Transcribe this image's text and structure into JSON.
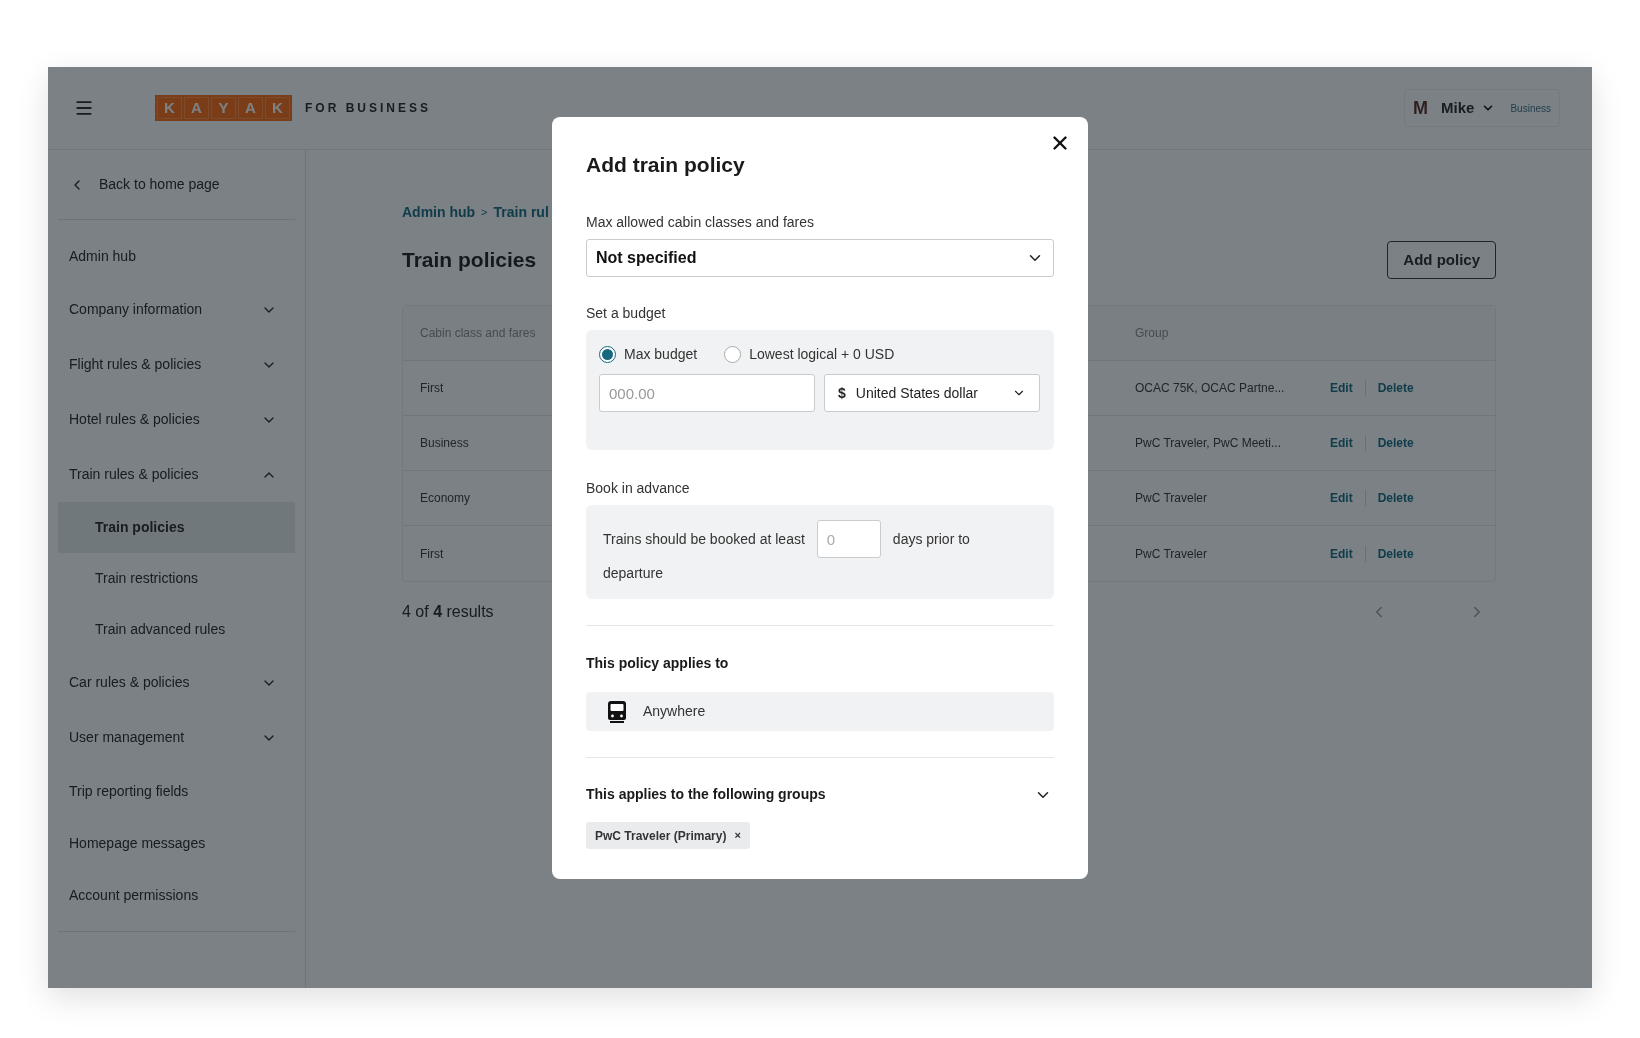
{
  "header": {
    "logo_letters": [
      "K",
      "A",
      "Y",
      "A",
      "K"
    ],
    "logo_suffix": "FOR BUSINESS",
    "user": {
      "initial": "M",
      "name": "Mike",
      "badge": "Business"
    }
  },
  "sidebar": {
    "back": "Back to home page",
    "items": [
      {
        "kind": "link",
        "label": "Admin hub",
        "selected": false
      },
      {
        "kind": "group",
        "label": "Company information",
        "expanded": false,
        "selected": false
      },
      {
        "kind": "group",
        "label": "Flight rules & policies",
        "expanded": false,
        "selected": false
      },
      {
        "kind": "group",
        "label": "Hotel rules & policies",
        "expanded": false,
        "selected": false
      },
      {
        "kind": "group",
        "label": "Train rules & policies",
        "expanded": true,
        "selected": false,
        "children": [
          {
            "label": "Train policies",
            "selected": true
          },
          {
            "label": "Train restrictions",
            "selected": false
          },
          {
            "label": "Train advanced rules",
            "selected": false
          }
        ]
      },
      {
        "kind": "group",
        "label": "Car rules & policies",
        "expanded": false,
        "selected": false
      },
      {
        "kind": "group",
        "label": "User management",
        "expanded": false,
        "selected": false
      },
      {
        "kind": "link",
        "label": "Trip reporting fields",
        "selected": false
      },
      {
        "kind": "link",
        "label": "Homepage messages",
        "selected": false
      },
      {
        "kind": "link",
        "label": "Account permissions",
        "selected": false
      }
    ]
  },
  "main": {
    "breadcrumb": [
      "Admin hub",
      "Train rul"
    ],
    "breadcrumb_separator": ">",
    "title": "Train policies",
    "add_button": "Add policy",
    "table": {
      "columns": [
        "Cabin class and fares",
        "Group"
      ],
      "rows": [
        {
          "cabin": "First",
          "group": "OCAC 75K, OCAC Partne...",
          "actions": [
            "Edit",
            "Delete"
          ]
        },
        {
          "cabin": "Business",
          "group": "PwC Traveler, PwC Meeti...",
          "actions": [
            "Edit",
            "Delete"
          ]
        },
        {
          "cabin": "Economy",
          "group": "PwC Traveler",
          "actions": [
            "Edit",
            "Delete"
          ]
        },
        {
          "cabin": "First",
          "group": "PwC Traveler",
          "actions": [
            "Edit",
            "Delete"
          ]
        }
      ]
    },
    "results": "4 of **4** results"
  },
  "modal": {
    "title": "Add train policy",
    "cabin_field": {
      "label": "Max allowed cabin classes and fares",
      "value": "Not specified"
    },
    "budget": {
      "label": "Set a budget",
      "options": [
        {
          "label": "Max budget",
          "selected": true
        },
        {
          "label": "Lowest logical + 0 USD",
          "selected": false
        }
      ],
      "amount": {
        "placeholder": "000.00"
      },
      "currency": {
        "symbol": "$",
        "value": "United States dollar"
      }
    },
    "advance": {
      "label": "Book in advance",
      "text_before": "Trains should be booked at least",
      "placeholder": "0",
      "text_after": "days prior to",
      "text_after_wrapped": "departure"
    },
    "applies": {
      "label": "This policy applies to",
      "location": "Anywhere"
    },
    "groups": {
      "label": "This applies to the following groups",
      "chips": [
        {
          "label": "PwC Traveler (Primary)",
          "remove": "×"
        }
      ]
    }
  }
}
